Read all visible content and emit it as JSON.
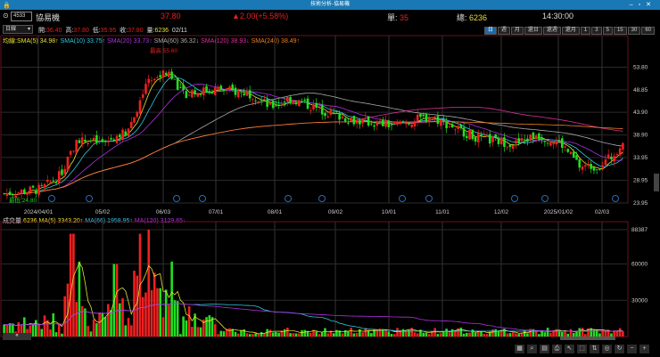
{
  "window": {
    "title": "技術分析-協易機",
    "lock_icon": "lock-icon"
  },
  "header": {
    "code": "4533",
    "name": "協易機",
    "price": "37.80",
    "change": "▲2.00(+5.58%)",
    "single_label": "單:",
    "single": "35",
    "total_label": "總:",
    "total": "6236",
    "time": "14:30:00"
  },
  "period_select": "日線",
  "ohlc": {
    "open_label": "開:",
    "open": "36.40",
    "high_label": "高:",
    "high": "37.80",
    "low_label": "低:",
    "low": "35.95",
    "close_label": "收:",
    "close": "37.80",
    "vol_label": "量:",
    "vol": "6236",
    "date": "02/11"
  },
  "periods": [
    "日",
    "週",
    "月",
    "還日",
    "還週",
    "還月",
    "1",
    "3",
    "5",
    "15",
    "30",
    "60"
  ],
  "ma_legend": [
    {
      "t": "均線:SMA(5) 34.98↑",
      "c": "#e8e030"
    },
    {
      "t": "SMA(10) 33.75↑",
      "c": "#30c8e0"
    },
    {
      "t": "SMA(20) 33.73↑",
      "c": "#b030e0"
    },
    {
      "t": "SMA(60) 36.32↓",
      "c": "#aaaaaa"
    },
    {
      "t": "SMA(120) 38.93↓",
      "c": "#e030a0"
    },
    {
      "t": "SMA(240) 38.49↑",
      "c": "#f08020"
    }
  ],
  "vol_legend": [
    {
      "t": "成交量 ",
      "c": "#dddddd"
    },
    {
      "t": "6236 ",
      "c": "#e8e030"
    },
    {
      "t": "MA(5) 3343.20↑ ",
      "c": "#e8e030"
    },
    {
      "t": "MA(66) 1958.95↑ ",
      "c": "#30c8e0"
    },
    {
      "t": "MA(120) 3129.65↓",
      "c": "#b030e0"
    }
  ],
  "high_mark": "最高:55.60",
  "low_mark": "最低:24.80",
  "chart_data": {
    "type": "candlestick",
    "price_ticks": [
      "53.80",
      "48.85",
      "43.90",
      "38.90",
      "33.95",
      "28.95",
      "23.95"
    ],
    "price_range": [
      23.95,
      58.8
    ],
    "volume_ticks": [
      "88387",
      "60000",
      "30000"
    ],
    "volume_max": 88387,
    "x_labels": [
      "2024/04/01",
      "05/02",
      "06/03",
      "07/01",
      "08/01",
      "09/02",
      "10/01",
      "11/01",
      "12/02",
      "2025/01/02",
      "02/03"
    ],
    "close_path": [
      [
        0,
        26
      ],
      [
        0.06,
        27
      ],
      [
        0.09,
        30
      ],
      [
        0.12,
        38
      ],
      [
        0.16,
        37
      ],
      [
        0.2,
        40
      ],
      [
        0.23,
        50
      ],
      [
        0.265,
        53
      ],
      [
        0.29,
        48
      ],
      [
        0.34,
        49
      ],
      [
        0.4,
        48
      ],
      [
        0.43,
        45
      ],
      [
        0.46,
        47
      ],
      [
        0.52,
        44
      ],
      [
        0.57,
        42
      ],
      [
        0.63,
        41
      ],
      [
        0.69,
        43
      ],
      [
        0.72,
        41
      ],
      [
        0.77,
        38
      ],
      [
        0.83,
        37
      ],
      [
        0.86,
        39
      ],
      [
        0.9,
        37
      ],
      [
        0.93,
        32
      ],
      [
        0.96,
        32
      ],
      [
        0.985,
        34.5
      ],
      [
        1,
        37.8
      ]
    ],
    "volume_spikes": [
      [
        0.11,
        85000
      ],
      [
        0.12,
        62000
      ],
      [
        0.18,
        60000
      ],
      [
        0.22,
        85000
      ],
      [
        0.235,
        88387
      ],
      [
        0.27,
        62000
      ],
      [
        0.25,
        40000
      ],
      [
        0.3,
        25000
      ]
    ]
  },
  "toolbar": [
    "▦",
    "⌕",
    "▤",
    "⎙",
    "↖",
    "⬚",
    "⇅",
    "◎",
    "↻",
    "−",
    "+"
  ]
}
